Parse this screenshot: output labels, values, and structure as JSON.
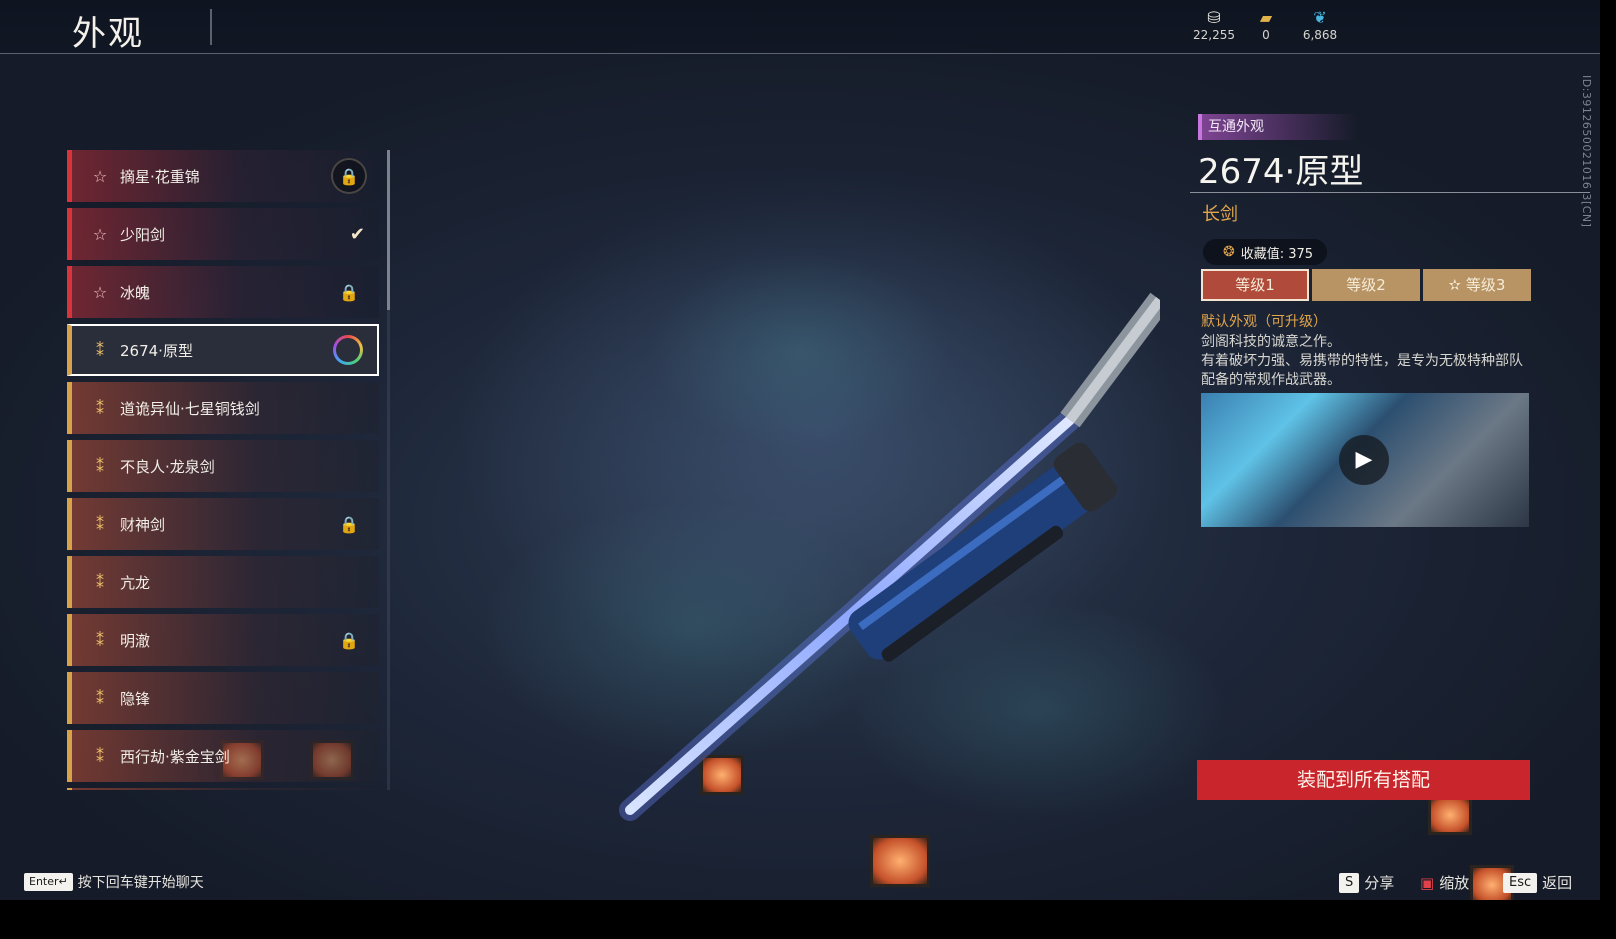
{
  "header": {
    "title": "外观",
    "currencies": [
      {
        "icon": "coin-stack-icon",
        "value": "22,255"
      },
      {
        "icon": "ticket-icon",
        "value": "0"
      },
      {
        "icon": "feather-icon",
        "value": "6,868"
      }
    ],
    "id_text": "ID:3912650021016 3[CN]"
  },
  "list": {
    "items": [
      {
        "name": "摘星·花重锦",
        "rarity": "red",
        "status": "locked"
      },
      {
        "name": "少阳剑",
        "rarity": "red",
        "status": "equipped"
      },
      {
        "name": "冰魄",
        "rarity": "red",
        "status": "locked"
      },
      {
        "name": "2674·原型",
        "rarity": "gold",
        "status": "selected"
      },
      {
        "name": "道诡异仙·七星铜钱剑",
        "rarity": "gold",
        "status": ""
      },
      {
        "name": "不良人·龙泉剑",
        "rarity": "gold",
        "status": ""
      },
      {
        "name": "财神剑",
        "rarity": "gold",
        "status": "locked"
      },
      {
        "name": "亢龙",
        "rarity": "gold",
        "status": ""
      },
      {
        "name": "明澈",
        "rarity": "gold",
        "status": "locked"
      },
      {
        "name": "隐锋",
        "rarity": "gold",
        "status": ""
      },
      {
        "name": "西行劫·紫金宝剑",
        "rarity": "gold",
        "status": ""
      }
    ]
  },
  "detail": {
    "tag": "互通外观",
    "title": "2674·原型",
    "type": "长剑",
    "collect_label": "收藏值: 375",
    "tabs": [
      "等级1",
      "等级2",
      "等级3"
    ],
    "active_tab": 0,
    "desc_head": "默认外观（可升级）",
    "desc_lines": [
      "剑阁科技的诚意之作。",
      "有着破坏力强、易携带的特性，是专为无极特种部队配备的常规作战武器。"
    ],
    "equip_button": "装配到所有搭配"
  },
  "footer": {
    "chat_key": "Enter↵",
    "chat_hint": "按下回车键开始聊天",
    "share_key": "S",
    "share_label": "分享",
    "zoom_label": "缩放",
    "back_key": "Esc",
    "back_label": "返回"
  },
  "colors": {
    "accent_red": "#c8262c",
    "accent_gold": "#e2a64b",
    "tag_purple": "#c776e0"
  }
}
